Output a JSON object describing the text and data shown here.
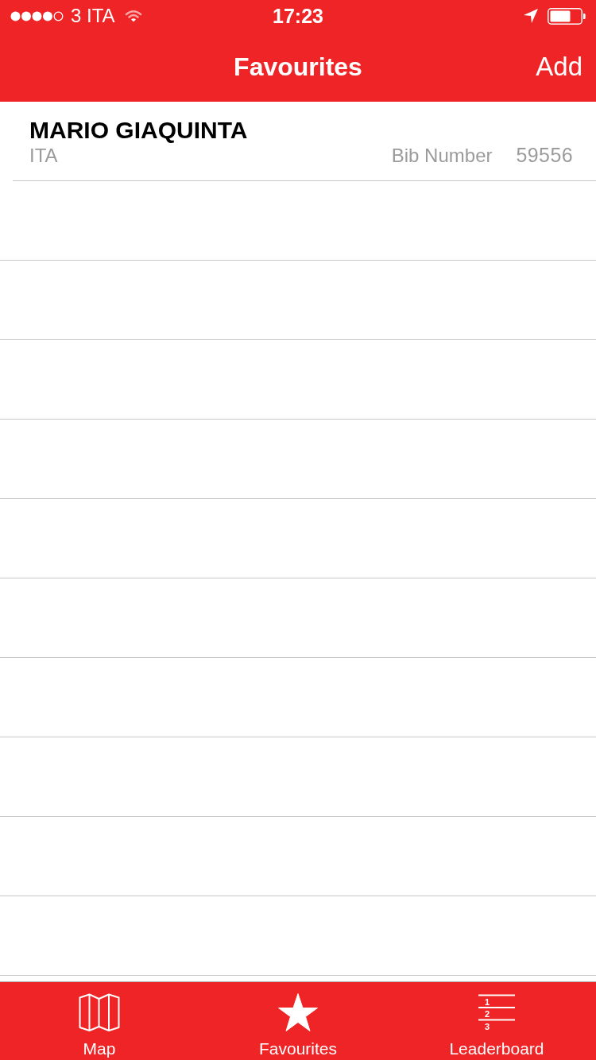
{
  "status_bar": {
    "carrier": "3 ITA",
    "time": "17:23"
  },
  "nav_bar": {
    "title": "Favourites",
    "action": "Add"
  },
  "favourites": [
    {
      "name": "MARIO GIAQUINTA",
      "country": "ITA",
      "bib_label": "Bib Number",
      "bib_number": "59556"
    }
  ],
  "tab_bar": {
    "tabs": [
      {
        "kind": "map",
        "label": "Map"
      },
      {
        "kind": "star",
        "label": "Favourites"
      },
      {
        "kind": "leaderboard",
        "label": "Leaderboard",
        "icon_labels": [
          "1",
          "2",
          "3"
        ]
      }
    ]
  }
}
